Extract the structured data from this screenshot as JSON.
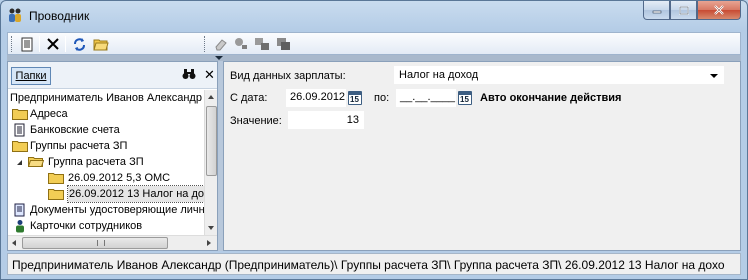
{
  "window": {
    "title": "Проводник"
  },
  "toolbar": {
    "buttons": [
      "document-icon",
      "delete-icon",
      "refresh-icon",
      "folder-open-icon",
      "eraser-icon",
      "stamp-icon",
      "copy-move-icon",
      "duplicate-icon"
    ]
  },
  "left_panel": {
    "tab_label": "Папки",
    "tree": [
      {
        "label": "Предприниматель Иванов Александр",
        "level": 0,
        "icon": "none"
      },
      {
        "label": "Адреса",
        "level": 0,
        "icon": "folder-icon"
      },
      {
        "label": "Банковские счета",
        "level": 0,
        "icon": "document-icon"
      },
      {
        "label": "Группы расчета ЗП",
        "level": 0,
        "icon": "folder-icon"
      },
      {
        "label": "Группа расчета ЗП",
        "level": 1,
        "icon": "folder-open-icon"
      },
      {
        "label": "26.09.2012  5,3 ОМС",
        "level": 2,
        "icon": "folder-icon"
      },
      {
        "label": "26.09.2012  13 Налог на дох",
        "level": 2,
        "icon": "folder-icon",
        "selected": true
      },
      {
        "label": "Документы удостоверяющие личн",
        "level": 0,
        "icon": "document-icon"
      },
      {
        "label": "Карточки сотрудников",
        "level": 0,
        "icon": "person-icon"
      }
    ]
  },
  "form": {
    "salary_type_label": "Вид данных зарплаты:",
    "salary_type_value": "Налог на доход",
    "from_label": "С дата:",
    "from_value": "26.09.2012",
    "to_label": "по:",
    "to_value": "__.__.____",
    "auto_end_label": "Авто окончание действия",
    "value_label": "Значение:",
    "value_value": "13",
    "calendar_digit": "15"
  },
  "status": {
    "path": "Предприниматель Иванов Александр (Предприниматель)\\ Группы расчета ЗП\\ Группа расчета ЗП\\ 26.09.2012  13 Налог на дохо"
  },
  "colors": {
    "accent": "#3d5e82",
    "window_frame": "#b4cce6",
    "close_button": "#c74b33"
  }
}
